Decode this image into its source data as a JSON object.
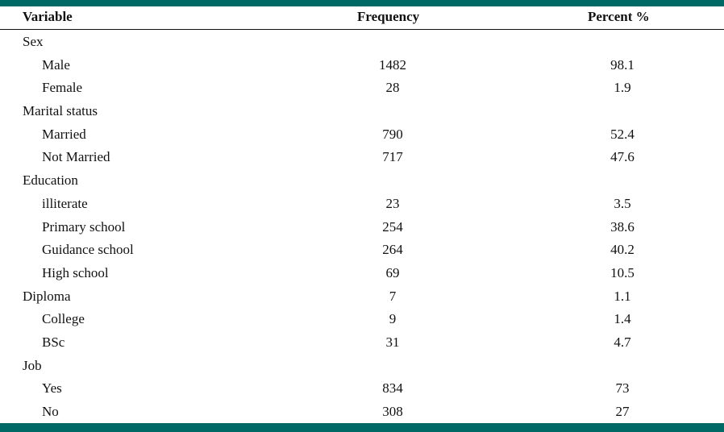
{
  "theme": {
    "accent_bar_color": "#006965"
  },
  "table": {
    "headers": {
      "variable": "Variable",
      "frequency": "Frequency",
      "percent": "Percent %"
    },
    "rows": [
      {
        "label": "Sex",
        "frequency": "",
        "percent": "",
        "type": "group"
      },
      {
        "label": "Male",
        "frequency": "1482",
        "percent": "98.1",
        "type": "item"
      },
      {
        "label": "Female",
        "frequency": "28",
        "percent": "1.9",
        "type": "item"
      },
      {
        "label": "Marital status",
        "frequency": "",
        "percent": "",
        "type": "group"
      },
      {
        "label": "Married",
        "frequency": "790",
        "percent": "52.4",
        "type": "item"
      },
      {
        "label": "Not Married",
        "frequency": "717",
        "percent": "47.6",
        "type": "item"
      },
      {
        "label": "Education",
        "frequency": "",
        "percent": "",
        "type": "group"
      },
      {
        "label": "illiterate",
        "frequency": "23",
        "percent": "3.5",
        "type": "item"
      },
      {
        "label": "Primary school",
        "frequency": "254",
        "percent": "38.6",
        "type": "item"
      },
      {
        "label": "Guidance school",
        "frequency": "264",
        "percent": "40.2",
        "type": "item"
      },
      {
        "label": "High school",
        "frequency": "69",
        "percent": "10.5",
        "type": "item"
      },
      {
        "label": "Diploma",
        "frequency": "7",
        "percent": "1.1",
        "type": "group"
      },
      {
        "label": "College",
        "frequency": "9",
        "percent": "1.4",
        "type": "item"
      },
      {
        "label": "BSc",
        "frequency": "31",
        "percent": "4.7",
        "type": "item"
      },
      {
        "label": "Job",
        "frequency": "",
        "percent": "",
        "type": "group"
      },
      {
        "label": "Yes",
        "frequency": "834",
        "percent": "73",
        "type": "item"
      },
      {
        "label": "No",
        "frequency": "308",
        "percent": "27",
        "type": "item"
      }
    ]
  }
}
